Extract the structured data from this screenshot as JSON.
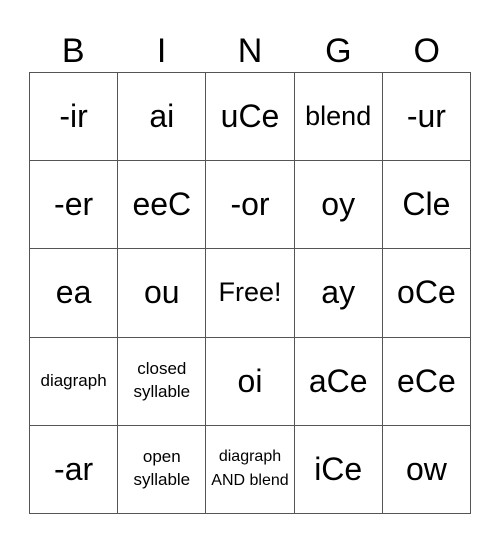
{
  "header": [
    "B",
    "I",
    "N",
    "G",
    "O"
  ],
  "cells": [
    {
      "text": "-ir",
      "size": "big"
    },
    {
      "text": "ai",
      "size": "big"
    },
    {
      "text": "uCe",
      "size": "big"
    },
    {
      "text": "blend",
      "size": "med"
    },
    {
      "text": "-ur",
      "size": "big"
    },
    {
      "text": "-er",
      "size": "big"
    },
    {
      "text": "eeC",
      "size": "big"
    },
    {
      "text": "-or",
      "size": "big"
    },
    {
      "text": "oy",
      "size": "big"
    },
    {
      "text": "Cle",
      "size": "big"
    },
    {
      "text": "ea",
      "size": "big"
    },
    {
      "text": "ou",
      "size": "big"
    },
    {
      "text": "Free!",
      "size": "med"
    },
    {
      "text": "ay",
      "size": "big"
    },
    {
      "text": "oCe",
      "size": "big"
    },
    {
      "text": "diagraph",
      "size": "small"
    },
    {
      "text": "closed syllable",
      "size": "small"
    },
    {
      "text": "oi",
      "size": "big"
    },
    {
      "text": "aCe",
      "size": "big"
    },
    {
      "text": "eCe",
      "size": "big"
    },
    {
      "text": "-ar",
      "size": "big"
    },
    {
      "text": "open syllable",
      "size": "small"
    },
    {
      "text": "diagraph AND blend",
      "size": "tiny"
    },
    {
      "text": "iCe",
      "size": "big"
    },
    {
      "text": "ow",
      "size": "big"
    }
  ]
}
